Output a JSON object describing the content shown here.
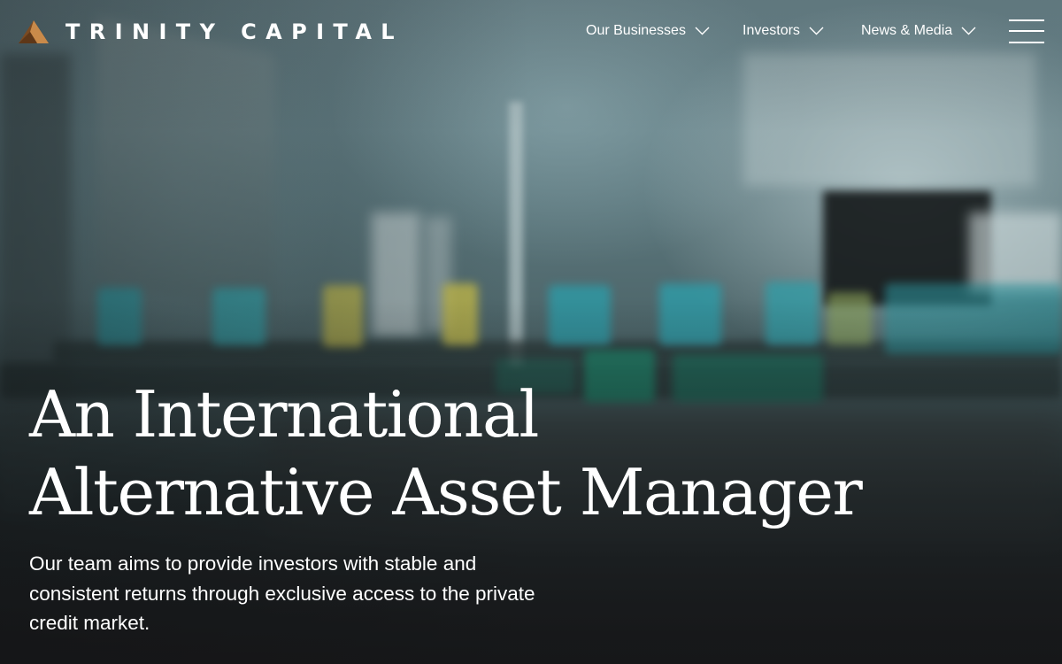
{
  "brand": {
    "name": "TRINITY CAPITAL",
    "logo_icon": "triangle-logo-icon",
    "colors": {
      "logo_dark": "#7a4a22",
      "logo_light": "#c98a4a"
    }
  },
  "nav": {
    "items": [
      {
        "label": "Our Businesses",
        "icon": "chevron-down-icon"
      },
      {
        "label": "Investors",
        "icon": "chevron-down-icon"
      },
      {
        "label": "News & Media",
        "icon": "chevron-down-icon"
      }
    ],
    "menu_icon": "hamburger-menu-icon"
  },
  "hero": {
    "headline_line1": "An International",
    "headline_line2": "Alternative Asset Manager",
    "subtext": "Our team aims to provide investors with stable and consistent returns through exclusive access to the private credit market.",
    "background": "motion-blurred manufacturing conveyor scene"
  }
}
